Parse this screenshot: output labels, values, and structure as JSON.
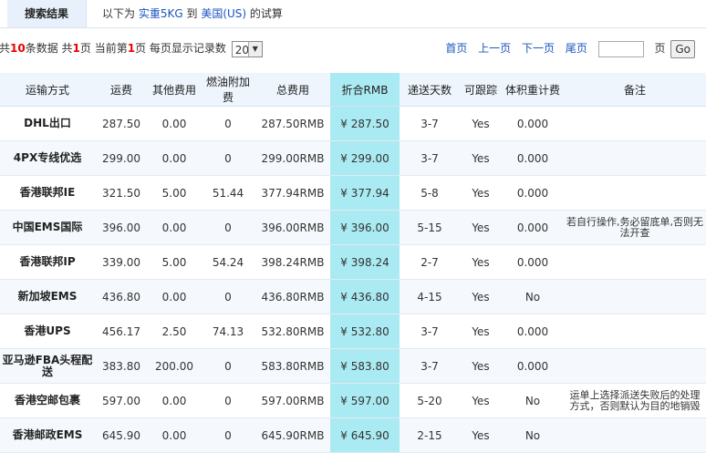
{
  "header": {
    "tab_label": "搜索结果",
    "query_prefix": "以下为",
    "weight_link": "实重5KG",
    "to_text": "到",
    "dest_link": "美国(US)",
    "suffix": "的试算"
  },
  "pager": {
    "text1": "共",
    "total": "10",
    "text2": "条数据 共",
    "pages": "1",
    "text3": "页 当前第",
    "current": "1",
    "text4": "页 每页显示记录数",
    "page_size": "20",
    "first": "首页",
    "prev": "上一页",
    "next": "下一页",
    "last": "尾页",
    "page_suffix": "页",
    "go": "Go"
  },
  "table": {
    "headers": [
      "运输方式",
      "运费",
      "其他费用",
      "燃油附加费",
      "总费用",
      "折合RMB",
      "递送天数",
      "可跟踪",
      "体积重计费",
      "备注"
    ],
    "rows": [
      {
        "method": "DHL出口",
        "fee": "287.50",
        "other": "0.00",
        "fuel": "0",
        "total": "287.50RMB",
        "rmb": "¥ 287.50",
        "days": "3-7",
        "track": "Yes",
        "vol": "0.000",
        "note": ""
      },
      {
        "method": "4PX专线优选",
        "fee": "299.00",
        "other": "0.00",
        "fuel": "0",
        "total": "299.00RMB",
        "rmb": "¥ 299.00",
        "days": "3-7",
        "track": "Yes",
        "vol": "0.000",
        "note": ""
      },
      {
        "method": "香港联邦IE",
        "fee": "321.50",
        "other": "5.00",
        "fuel": "51.44",
        "total": "377.94RMB",
        "rmb": "¥ 377.94",
        "days": "5-8",
        "track": "Yes",
        "vol": "0.000",
        "note": ""
      },
      {
        "method": "中国EMS国际",
        "fee": "396.00",
        "other": "0.00",
        "fuel": "0",
        "total": "396.00RMB",
        "rmb": "¥ 396.00",
        "days": "5-15",
        "track": "Yes",
        "vol": "0.000",
        "note": "若自行操作,务必留底单,否则无法开查"
      },
      {
        "method": "香港联邦IP",
        "fee": "339.00",
        "other": "5.00",
        "fuel": "54.24",
        "total": "398.24RMB",
        "rmb": "¥ 398.24",
        "days": "2-7",
        "track": "Yes",
        "vol": "0.000",
        "note": ""
      },
      {
        "method": "新加坡EMS",
        "fee": "436.80",
        "other": "0.00",
        "fuel": "0",
        "total": "436.80RMB",
        "rmb": "¥ 436.80",
        "days": "4-15",
        "track": "Yes",
        "vol": "No",
        "note": ""
      },
      {
        "method": "香港UPS",
        "fee": "456.17",
        "other": "2.50",
        "fuel": "74.13",
        "total": "532.80RMB",
        "rmb": "¥ 532.80",
        "days": "3-7",
        "track": "Yes",
        "vol": "0.000",
        "note": ""
      },
      {
        "method": "亚马逊FBA头程配送",
        "fee": "383.80",
        "other": "200.00",
        "fuel": "0",
        "total": "583.80RMB",
        "rmb": "¥ 583.80",
        "days": "3-7",
        "track": "Yes",
        "vol": "0.000",
        "note": ""
      },
      {
        "method": "香港空邮包裹",
        "fee": "597.00",
        "other": "0.00",
        "fuel": "0",
        "total": "597.00RMB",
        "rmb": "¥ 597.00",
        "days": "5-20",
        "track": "Yes",
        "vol": "No",
        "note": "运单上选择派送失败后的处理方式，否则默认为目的地销毁"
      },
      {
        "method": "香港邮政EMS",
        "fee": "645.90",
        "other": "0.00",
        "fuel": "0",
        "total": "645.90RMB",
        "rmb": "¥ 645.90",
        "days": "2-15",
        "track": "Yes",
        "vol": "No",
        "note": ""
      }
    ]
  }
}
